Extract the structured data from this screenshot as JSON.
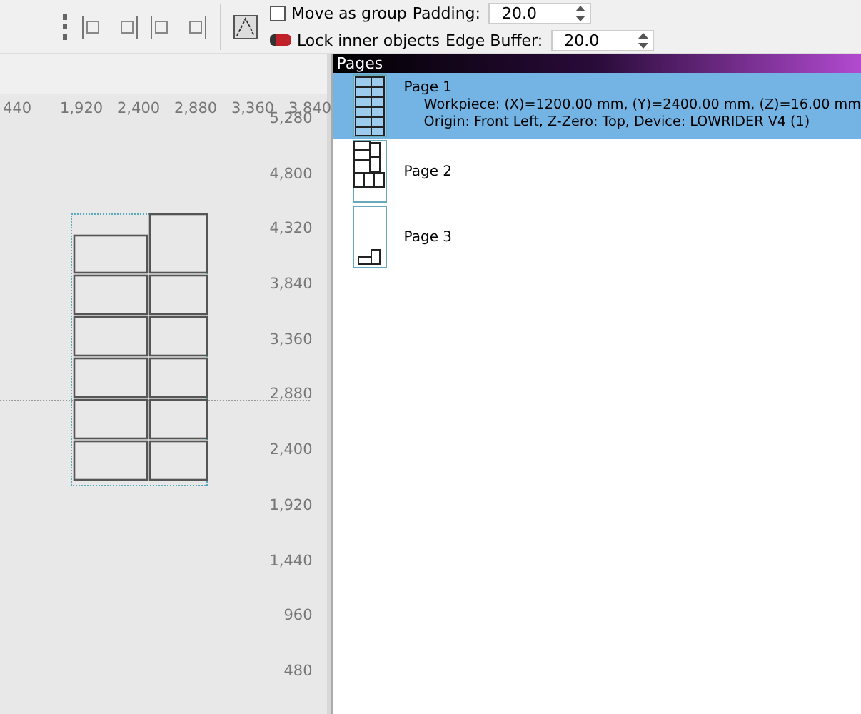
{
  "toolbar": {
    "move_as_group": {
      "label": "Move as group",
      "checked": false
    },
    "padding": {
      "label": "Padding:",
      "value": "20.0"
    },
    "lock_inner_objects": {
      "label": "Lock inner objects",
      "on": true
    },
    "edge_buffer": {
      "label": "Edge Buffer:",
      "value": "20.0"
    }
  },
  "canvas": {
    "x_ruler": [
      "440",
      "1,920",
      "2,400",
      "2,880",
      "3,360",
      "3,840"
    ],
    "y_ruler": [
      "5,280",
      "4,800",
      "4,320",
      "3,840",
      "3,360",
      "2,880",
      "2,400",
      "1,920",
      "1,440",
      "960",
      "480"
    ]
  },
  "pages_panel": {
    "title": "Pages",
    "items": [
      {
        "name": "Page 1",
        "selected": true,
        "details": [
          "Workpiece: (X)=1200.00 mm, (Y)=2400.00 mm, (Z)=16.00 mm",
          "Origin: Front Left, Z-Zero: Top, Device: LOWRIDER V4 (1)"
        ]
      },
      {
        "name": "Page 2",
        "selected": false
      },
      {
        "name": "Page 3",
        "selected": false
      }
    ]
  }
}
